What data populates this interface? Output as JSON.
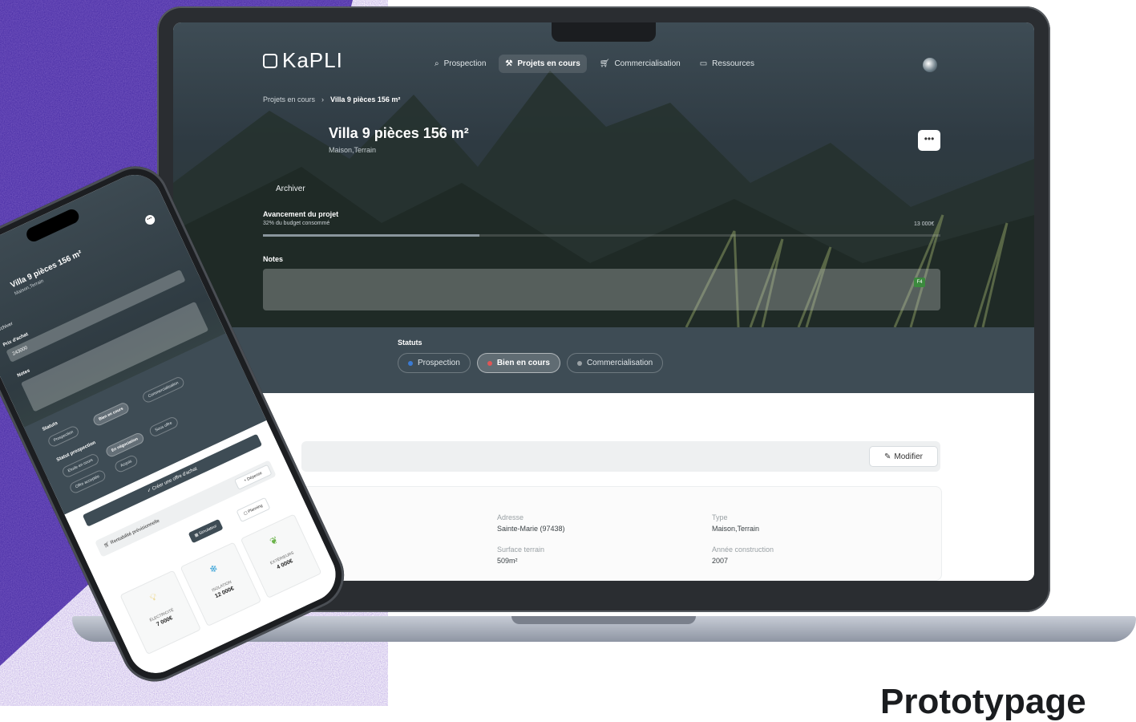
{
  "app": {
    "logo_text": "KaPLI"
  },
  "nav": {
    "items": [
      {
        "label": "Prospection",
        "icon": "search-icon"
      },
      {
        "label": "Projets en cours",
        "icon": "hammer-icon",
        "active": true
      },
      {
        "label": "Commercialisation",
        "icon": "cart-icon"
      },
      {
        "label": "Ressources",
        "icon": "folder-icon"
      }
    ]
  },
  "breadcrumb": {
    "parent": "Projets en cours",
    "separator": "›",
    "current": "Villa 9 pièces 156 m²"
  },
  "project": {
    "title": "Villa 9 pièces 156 m²",
    "subtitle": "Maison,Terrain",
    "more_label": "•••",
    "archive_label": "Archiver"
  },
  "progress": {
    "title": "Avancement du projet",
    "subtitle": "32% du budget consommé",
    "amount": "13 000€",
    "value": 0.32
  },
  "notes": {
    "label": "Notes",
    "badge": "F4"
  },
  "statuts": {
    "title": "Statuts",
    "chips": [
      {
        "label": "Prospection",
        "color": "#3a7bd5"
      },
      {
        "label": "Bien en cours",
        "color": "#e05555",
        "active": true
      },
      {
        "label": "Commercialisation",
        "color": "#9aa1a5"
      }
    ]
  },
  "details": {
    "edit_label": "Modifier",
    "fields": [
      {
        "label": "Adresse",
        "value": "Sainte-Marie (97438)"
      },
      {
        "label": "Type",
        "value": "Maison,Terrain"
      },
      {
        "label": "Surface terrain",
        "value": "509m²"
      },
      {
        "label": "Année construction",
        "value": "2007"
      }
    ]
  },
  "mobile": {
    "title": "Villa 9 pièces 156 m²",
    "subtitle": "Maison,Terrain",
    "archive_label": "Archiver",
    "price_label": "Prix d'achat",
    "price_value": "243000",
    "notes_label": "Notes",
    "statuts_label": "Statuts",
    "statuts": [
      "Prospection",
      "Bien en cours",
      "Commercialisation"
    ],
    "prospect_label": "Statut prospection",
    "prospect": [
      "Etude en cours",
      "En négociation",
      "Sous offre",
      "Offre acceptée",
      "Acquis"
    ],
    "cta": "✓ Créer une offre d'achat",
    "rent_label": "Rentabilité prévisionnelle",
    "depense_label": "+ Dépense",
    "tabs": [
      "Simulateur",
      "Planning"
    ],
    "cards": [
      {
        "icon": "bulb-icon",
        "name": "ÉLECTRICITÉ",
        "value": "7 000€"
      },
      {
        "icon": "snowflake-icon",
        "name": "ISOLATION",
        "value": "12 000€"
      },
      {
        "icon": "leaf-icon",
        "name": "EXTÉRIEURS",
        "value": "4 000€"
      }
    ]
  },
  "tagline": "Prototypage",
  "colors": {
    "purple": "#4b2fa8",
    "slate": "#3e4c55",
    "accent_green": "#3c8a3e"
  }
}
